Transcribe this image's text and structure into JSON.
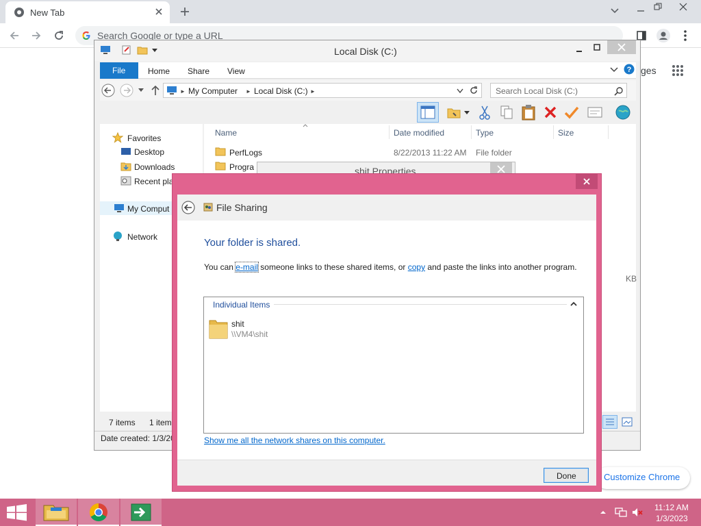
{
  "browser": {
    "tab_title": "New Tab",
    "omnibox_placeholder": "Search Google or type a URL",
    "partial_right_text": "ges",
    "customize_label": "Customize Chrome"
  },
  "explorer": {
    "title": "Local Disk (C:)",
    "ribbon_tabs": [
      "File",
      "Home",
      "Share",
      "View"
    ],
    "breadcrumb": [
      "My Computer",
      "Local Disk (C:)"
    ],
    "search_placeholder": "Search Local Disk (C:)",
    "nav": {
      "favorites": "Favorites",
      "desktop": "Desktop",
      "downloads": "Downloads",
      "recent": "Recent pla",
      "computer": "My Comput",
      "network": "Network"
    },
    "columns": [
      "Name",
      "Date modified",
      "Type",
      "Size"
    ],
    "files": [
      {
        "name": "PerfLogs",
        "date": "8/22/2013 11:22 AM",
        "type": "File folder"
      },
      {
        "name": "Progra",
        "date": "",
        "type": ""
      }
    ],
    "partial_size": "KB",
    "status_items": "7 items",
    "status_selected": "1 item",
    "details_text": "Date created: 1/3/20"
  },
  "props_window": {
    "title": "shit Properties"
  },
  "dialog": {
    "title": "File Sharing",
    "heading": "Your folder is shared.",
    "msg_part1": "You can ",
    "msg_email": "e-mail",
    "msg_part2": " someone links to these shared items, or ",
    "msg_copy": "copy",
    "msg_part3": " and paste the links into another program.",
    "group_title": "Individual Items",
    "item_name": "shit",
    "item_path": "\\\\VM4\\shit",
    "shares_link": "Show me all the network shares on this computer.",
    "done_label": "Done"
  },
  "taskbar": {
    "time": "11:12 AM",
    "date": "1/3/2023"
  },
  "colors": {
    "accent_pink": "#e1638f",
    "taskbar": "#cf6487",
    "link": "#0066cc",
    "heading_blue": "#1f4e9c"
  }
}
